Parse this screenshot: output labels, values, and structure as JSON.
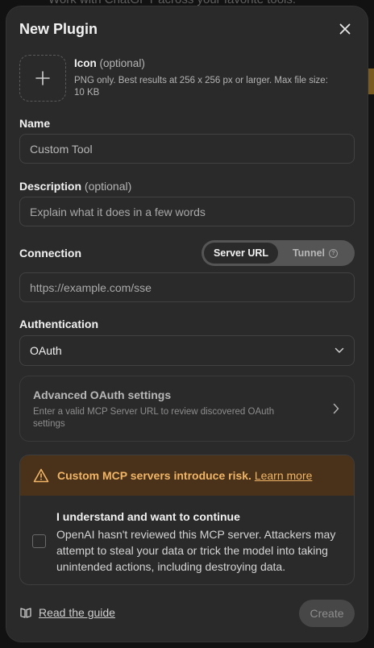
{
  "background": {
    "top_text": "Work with ChatGPT across your favorite tools."
  },
  "modal": {
    "title": "New Plugin"
  },
  "icon_section": {
    "title": "Icon",
    "optional": "(optional)",
    "description": "PNG only. Best results at 256 x 256 px or larger. Max file size: 10 KB"
  },
  "name": {
    "label": "Name",
    "value": "Custom Tool"
  },
  "description": {
    "label": "Description",
    "optional": "(optional)",
    "placeholder": "Explain what it does in a few words"
  },
  "connection": {
    "label": "Connection",
    "options": [
      "Server URL",
      "Tunnel"
    ],
    "selected": "Server URL",
    "url_placeholder": "https://example.com/sse"
  },
  "authentication": {
    "label": "Authentication",
    "selected": "OAuth"
  },
  "advanced": {
    "title": "Advanced OAuth settings",
    "description": "Enter a valid MCP Server URL to review discovered OAuth settings"
  },
  "warning": {
    "headline": "Custom MCP servers introduce risk.",
    "learn_more": "Learn more",
    "check_title": "I understand and want to continue",
    "check_text": "OpenAI hasn't reviewed this MCP server. Attackers may attempt to steal your data or trick the model into taking unintended actions, including destroying data.",
    "checked": false
  },
  "footer": {
    "guide_label": "Read the guide",
    "create_label": "Create"
  },
  "colors": {
    "modal_bg": "#2a2a2a",
    "warning_bg": "#4a3119",
    "warning_text": "#f0b566"
  }
}
